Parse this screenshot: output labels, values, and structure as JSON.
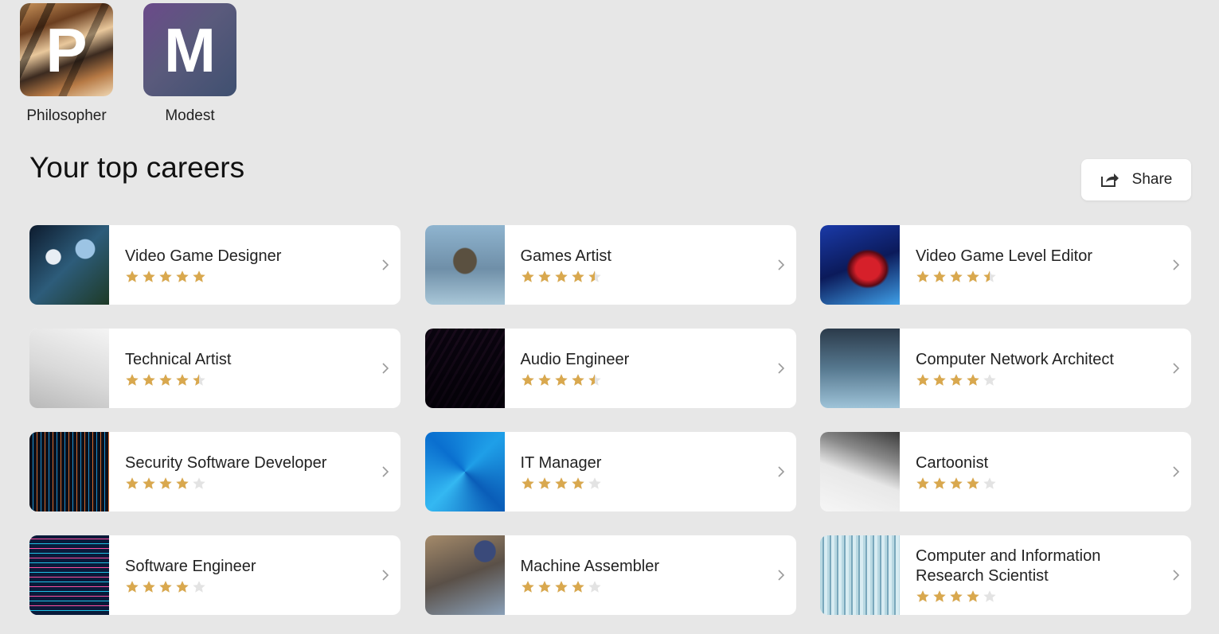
{
  "archetypes": [
    {
      "letter": "P",
      "label": "Philosopher"
    },
    {
      "letter": "M",
      "label": "Modest"
    }
  ],
  "section": {
    "title": "Your top careers",
    "share_label": "Share"
  },
  "colors": {
    "background": "#e7e7e7",
    "card": "#ffffff",
    "star_filled": "#d9a84e",
    "star_empty": "#e3e3e3",
    "chevron": "#9a9a9a"
  },
  "careers": [
    {
      "title": "Video Game Designer",
      "rating": 5
    },
    {
      "title": "Games Artist",
      "rating": 4.5
    },
    {
      "title": "Video Game Level Editor",
      "rating": 4.5
    },
    {
      "title": "Technical Artist",
      "rating": 4.5
    },
    {
      "title": "Audio Engineer",
      "rating": 4.5
    },
    {
      "title": "Computer Network Architect",
      "rating": 4
    },
    {
      "title": "Security Software Developer",
      "rating": 4
    },
    {
      "title": "IT Manager",
      "rating": 4
    },
    {
      "title": "Cartoonist",
      "rating": 4
    },
    {
      "title": "Software Engineer",
      "rating": 4
    },
    {
      "title": "Machine Assembler",
      "rating": 4
    },
    {
      "title": "Computer and Information Research Scientist",
      "rating": 4
    }
  ],
  "icons": {
    "share": "share-arrow-icon",
    "chevron": "chevron-right-icon",
    "star": "star-icon"
  }
}
